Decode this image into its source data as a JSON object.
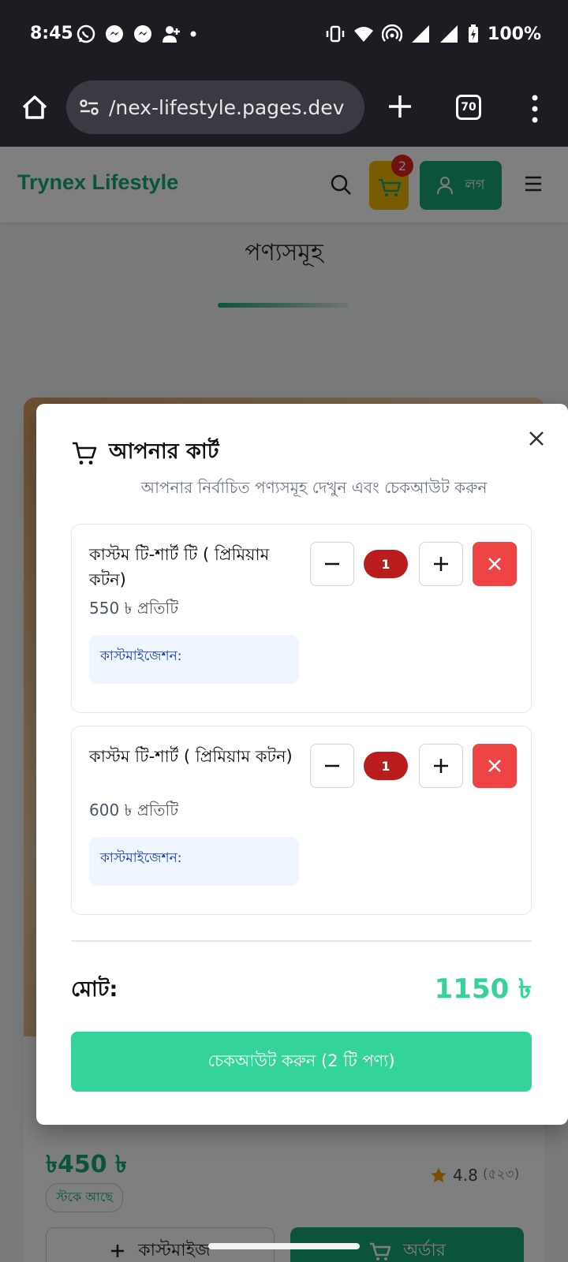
{
  "status_bar": {
    "time": "8:45",
    "battery": "100%",
    "left_icons": [
      "whatsapp-icon",
      "messenger-icon",
      "messenger-icon",
      "person-add-icon",
      "dot-icon"
    ],
    "right_icons": [
      "vibrate-icon",
      "wifi-icon",
      "hotspot-icon",
      "signal-icon",
      "signal-icon",
      "battery-charging-icon"
    ]
  },
  "browser": {
    "url": "/nex-lifestyle.pages.dev",
    "tab_count": "70"
  },
  "site": {
    "brand": "Trynex Lifestyle",
    "cart_count": "2",
    "login_label": "লগ",
    "section_title": "পণ্যসমূহ",
    "product": {
      "price": "৳450 ৳",
      "stock": "স্টকে আছে",
      "rating": "4.8",
      "rating_count": "(৫২৩)",
      "customize_label": "কাস্টমাইজ",
      "order_label": "অর্ডার"
    }
  },
  "cart_modal": {
    "title": "আপনার কার্ট",
    "subtitle": "আপনার নির্বাচিত পণ্যসমূহ দেখুন এবং চেকআউট করুন",
    "items": [
      {
        "name": "কাস্টম টি-শার্ট টি ( প্রিমিয়াম কটন)",
        "price": "550 ৳ প্রতিটি",
        "quantity": "1",
        "customization_label": "কাস্টমাইজেশন:"
      },
      {
        "name": "কাস্টম টি-শার্ট ( প্রিমিয়াম কটন)",
        "price": "600 ৳ প্রতিটি",
        "quantity": "1",
        "customization_label": "কাস্টমাইজেশন:"
      }
    ],
    "total_label": "মোট:",
    "total_value": "1150 ৳",
    "checkout_label": "চেকআউট করুন (2 টি পণ্য)"
  },
  "colors": {
    "brand_green": "#17a673",
    "accent_green": "#34d399",
    "remove_red": "#ef4444",
    "qty_red": "#b91c1c",
    "cart_yellow": "#f5b800"
  }
}
